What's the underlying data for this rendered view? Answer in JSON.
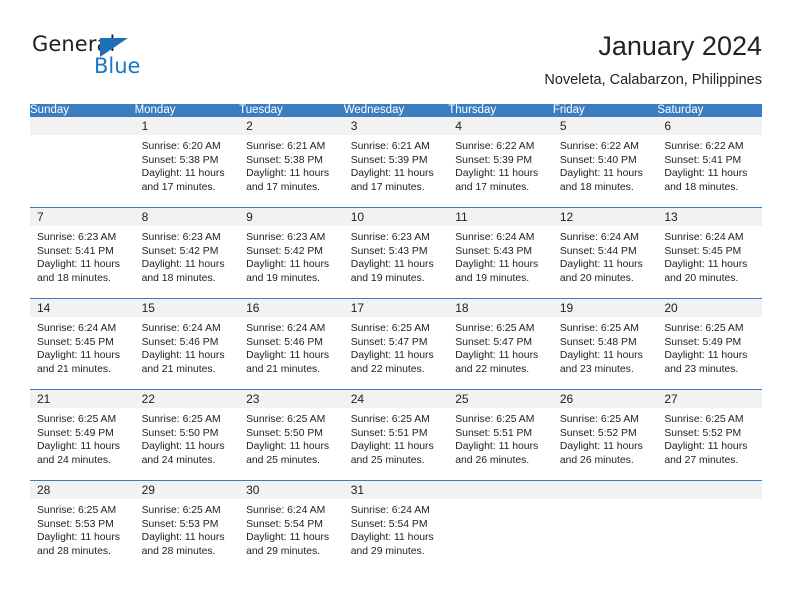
{
  "brand": {
    "name_part1": "General",
    "name_part2": "Blue",
    "triangle_color": "#1d70b8",
    "blue_color": "#1878c4"
  },
  "header": {
    "title": "January 2024",
    "subtitle": "Noveleta, Calabarzon, Philippines"
  },
  "theme": {
    "header_row_bg": "#3b7dc0",
    "daynum_band_bg": "#f2f2f2",
    "week_divider": "#3b7dc0",
    "text": "#222222"
  },
  "weekday_headers": [
    "Sunday",
    "Monday",
    "Tuesday",
    "Wednesday",
    "Thursday",
    "Friday",
    "Saturday"
  ],
  "weeks": [
    [
      {
        "day": "",
        "sunrise": "",
        "sunset": "",
        "daylight_line1": "",
        "daylight_line2": ""
      },
      {
        "day": "1",
        "sunrise": "Sunrise: 6:20 AM",
        "sunset": "Sunset: 5:38 PM",
        "daylight_line1": "Daylight: 11 hours",
        "daylight_line2": "and 17 minutes."
      },
      {
        "day": "2",
        "sunrise": "Sunrise: 6:21 AM",
        "sunset": "Sunset: 5:38 PM",
        "daylight_line1": "Daylight: 11 hours",
        "daylight_line2": "and 17 minutes."
      },
      {
        "day": "3",
        "sunrise": "Sunrise: 6:21 AM",
        "sunset": "Sunset: 5:39 PM",
        "daylight_line1": "Daylight: 11 hours",
        "daylight_line2": "and 17 minutes."
      },
      {
        "day": "4",
        "sunrise": "Sunrise: 6:22 AM",
        "sunset": "Sunset: 5:39 PM",
        "daylight_line1": "Daylight: 11 hours",
        "daylight_line2": "and 17 minutes."
      },
      {
        "day": "5",
        "sunrise": "Sunrise: 6:22 AM",
        "sunset": "Sunset: 5:40 PM",
        "daylight_line1": "Daylight: 11 hours",
        "daylight_line2": "and 18 minutes."
      },
      {
        "day": "6",
        "sunrise": "Sunrise: 6:22 AM",
        "sunset": "Sunset: 5:41 PM",
        "daylight_line1": "Daylight: 11 hours",
        "daylight_line2": "and 18 minutes."
      }
    ],
    [
      {
        "day": "7",
        "sunrise": "Sunrise: 6:23 AM",
        "sunset": "Sunset: 5:41 PM",
        "daylight_line1": "Daylight: 11 hours",
        "daylight_line2": "and 18 minutes."
      },
      {
        "day": "8",
        "sunrise": "Sunrise: 6:23 AM",
        "sunset": "Sunset: 5:42 PM",
        "daylight_line1": "Daylight: 11 hours",
        "daylight_line2": "and 18 minutes."
      },
      {
        "day": "9",
        "sunrise": "Sunrise: 6:23 AM",
        "sunset": "Sunset: 5:42 PM",
        "daylight_line1": "Daylight: 11 hours",
        "daylight_line2": "and 19 minutes."
      },
      {
        "day": "10",
        "sunrise": "Sunrise: 6:23 AM",
        "sunset": "Sunset: 5:43 PM",
        "daylight_line1": "Daylight: 11 hours",
        "daylight_line2": "and 19 minutes."
      },
      {
        "day": "11",
        "sunrise": "Sunrise: 6:24 AM",
        "sunset": "Sunset: 5:43 PM",
        "daylight_line1": "Daylight: 11 hours",
        "daylight_line2": "and 19 minutes."
      },
      {
        "day": "12",
        "sunrise": "Sunrise: 6:24 AM",
        "sunset": "Sunset: 5:44 PM",
        "daylight_line1": "Daylight: 11 hours",
        "daylight_line2": "and 20 minutes."
      },
      {
        "day": "13",
        "sunrise": "Sunrise: 6:24 AM",
        "sunset": "Sunset: 5:45 PM",
        "daylight_line1": "Daylight: 11 hours",
        "daylight_line2": "and 20 minutes."
      }
    ],
    [
      {
        "day": "14",
        "sunrise": "Sunrise: 6:24 AM",
        "sunset": "Sunset: 5:45 PM",
        "daylight_line1": "Daylight: 11 hours",
        "daylight_line2": "and 21 minutes."
      },
      {
        "day": "15",
        "sunrise": "Sunrise: 6:24 AM",
        "sunset": "Sunset: 5:46 PM",
        "daylight_line1": "Daylight: 11 hours",
        "daylight_line2": "and 21 minutes."
      },
      {
        "day": "16",
        "sunrise": "Sunrise: 6:24 AM",
        "sunset": "Sunset: 5:46 PM",
        "daylight_line1": "Daylight: 11 hours",
        "daylight_line2": "and 21 minutes."
      },
      {
        "day": "17",
        "sunrise": "Sunrise: 6:25 AM",
        "sunset": "Sunset: 5:47 PM",
        "daylight_line1": "Daylight: 11 hours",
        "daylight_line2": "and 22 minutes."
      },
      {
        "day": "18",
        "sunrise": "Sunrise: 6:25 AM",
        "sunset": "Sunset: 5:47 PM",
        "daylight_line1": "Daylight: 11 hours",
        "daylight_line2": "and 22 minutes."
      },
      {
        "day": "19",
        "sunrise": "Sunrise: 6:25 AM",
        "sunset": "Sunset: 5:48 PM",
        "daylight_line1": "Daylight: 11 hours",
        "daylight_line2": "and 23 minutes."
      },
      {
        "day": "20",
        "sunrise": "Sunrise: 6:25 AM",
        "sunset": "Sunset: 5:49 PM",
        "daylight_line1": "Daylight: 11 hours",
        "daylight_line2": "and 23 minutes."
      }
    ],
    [
      {
        "day": "21",
        "sunrise": "Sunrise: 6:25 AM",
        "sunset": "Sunset: 5:49 PM",
        "daylight_line1": "Daylight: 11 hours",
        "daylight_line2": "and 24 minutes."
      },
      {
        "day": "22",
        "sunrise": "Sunrise: 6:25 AM",
        "sunset": "Sunset: 5:50 PM",
        "daylight_line1": "Daylight: 11 hours",
        "daylight_line2": "and 24 minutes."
      },
      {
        "day": "23",
        "sunrise": "Sunrise: 6:25 AM",
        "sunset": "Sunset: 5:50 PM",
        "daylight_line1": "Daylight: 11 hours",
        "daylight_line2": "and 25 minutes."
      },
      {
        "day": "24",
        "sunrise": "Sunrise: 6:25 AM",
        "sunset": "Sunset: 5:51 PM",
        "daylight_line1": "Daylight: 11 hours",
        "daylight_line2": "and 25 minutes."
      },
      {
        "day": "25",
        "sunrise": "Sunrise: 6:25 AM",
        "sunset": "Sunset: 5:51 PM",
        "daylight_line1": "Daylight: 11 hours",
        "daylight_line2": "and 26 minutes."
      },
      {
        "day": "26",
        "sunrise": "Sunrise: 6:25 AM",
        "sunset": "Sunset: 5:52 PM",
        "daylight_line1": "Daylight: 11 hours",
        "daylight_line2": "and 26 minutes."
      },
      {
        "day": "27",
        "sunrise": "Sunrise: 6:25 AM",
        "sunset": "Sunset: 5:52 PM",
        "daylight_line1": "Daylight: 11 hours",
        "daylight_line2": "and 27 minutes."
      }
    ],
    [
      {
        "day": "28",
        "sunrise": "Sunrise: 6:25 AM",
        "sunset": "Sunset: 5:53 PM",
        "daylight_line1": "Daylight: 11 hours",
        "daylight_line2": "and 28 minutes."
      },
      {
        "day": "29",
        "sunrise": "Sunrise: 6:25 AM",
        "sunset": "Sunset: 5:53 PM",
        "daylight_line1": "Daylight: 11 hours",
        "daylight_line2": "and 28 minutes."
      },
      {
        "day": "30",
        "sunrise": "Sunrise: 6:24 AM",
        "sunset": "Sunset: 5:54 PM",
        "daylight_line1": "Daylight: 11 hours",
        "daylight_line2": "and 29 minutes."
      },
      {
        "day": "31",
        "sunrise": "Sunrise: 6:24 AM",
        "sunset": "Sunset: 5:54 PM",
        "daylight_line1": "Daylight: 11 hours",
        "daylight_line2": "and 29 minutes."
      },
      {
        "day": "",
        "sunrise": "",
        "sunset": "",
        "daylight_line1": "",
        "daylight_line2": ""
      },
      {
        "day": "",
        "sunrise": "",
        "sunset": "",
        "daylight_line1": "",
        "daylight_line2": ""
      },
      {
        "day": "",
        "sunrise": "",
        "sunset": "",
        "daylight_line1": "",
        "daylight_line2": ""
      }
    ]
  ]
}
